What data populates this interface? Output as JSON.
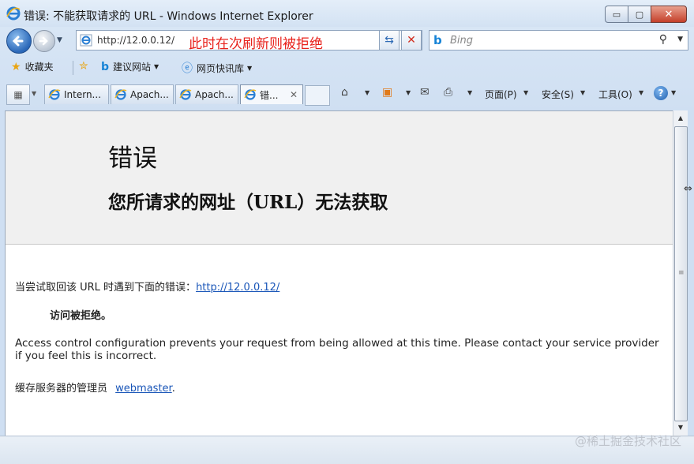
{
  "window": {
    "title": "错误: 不能获取请求的 URL - Windows Internet Explorer",
    "minimize": "▭",
    "maximize": "▢",
    "close": "✕"
  },
  "addressbar": {
    "url": "http://12.0.0.12/",
    "annotation": "此时在次刷新则被拒绝",
    "search_placeholder": "Bing",
    "refresh_glyph": "⇆",
    "stop_glyph": "✕"
  },
  "favorites": {
    "favorites_label": "收藏夹",
    "suggested_sites_label": "建议网站",
    "web_slice_label": "网页快讯库"
  },
  "tabs": [
    {
      "label": "Intern..."
    },
    {
      "label": "Apach..."
    },
    {
      "label": "Apach..."
    },
    {
      "label": "错..."
    }
  ],
  "commandbar": {
    "page_label": "页面(P)",
    "safety_label": "安全(S)",
    "tools_label": "工具(O)",
    "help_glyph": "?"
  },
  "page": {
    "error_title": "错误",
    "error_subtitle": "您所请求的网址（URL）无法获取",
    "attempt_text": "当尝试取回该 URL 时遇到下面的错误：",
    "attempt_link": "http://12.0.0.12/",
    "error_detail": "访问被拒绝。",
    "access_message": "Access control configuration prevents your request from being allowed at this time. Please contact your service provider if you feel this is incorrect.",
    "admin_text": "缓存服务器的管理员",
    "admin_link": "webmaster",
    "admin_suffix": "."
  },
  "watermark": "@稀土掘金技术社区",
  "colors": {
    "annotation_red": "#e8211b",
    "link_blue": "#1a56b8",
    "close_red": "#c4402b"
  }
}
